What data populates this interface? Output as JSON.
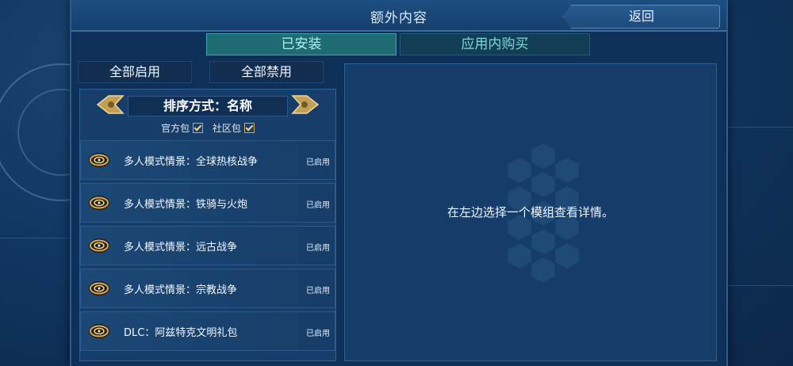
{
  "window": {
    "title": "额外内容",
    "back_label": "返回"
  },
  "tabs": [
    {
      "label": "已安装",
      "active": true
    },
    {
      "label": "应用内购买",
      "active": false
    }
  ],
  "actions": {
    "enable_all": "全部启用",
    "disable_all": "全部禁用"
  },
  "sort": {
    "label": "排序方式：名称"
  },
  "filters": [
    {
      "label": "官方包",
      "checked": true
    },
    {
      "label": "社区包",
      "checked": true
    }
  ],
  "mods": [
    {
      "name": "多人模式情景：全球热核战争",
      "status": "已启用"
    },
    {
      "name": "多人模式情景：铁骑与火炮",
      "status": "已启用"
    },
    {
      "name": "多人模式情景：远古战争",
      "status": "已启用"
    },
    {
      "name": "多人模式情景：宗教战争",
      "status": "已启用"
    },
    {
      "name": "DLC：阿兹特克文明礼包",
      "status": "已启用"
    }
  ],
  "detail": {
    "placeholder": "在左边选择一个模组查看详情。"
  },
  "colors": {
    "accent_gold": "#c9a95a",
    "tab_active": "#1f6b73",
    "panel_bg": "#163d6a"
  },
  "icons": {
    "mod": "swirl-galaxy-icon",
    "arrow_left": "arrow-left-icon",
    "arrow_right": "arrow-right-icon",
    "check": "checkbox-checked-icon"
  }
}
